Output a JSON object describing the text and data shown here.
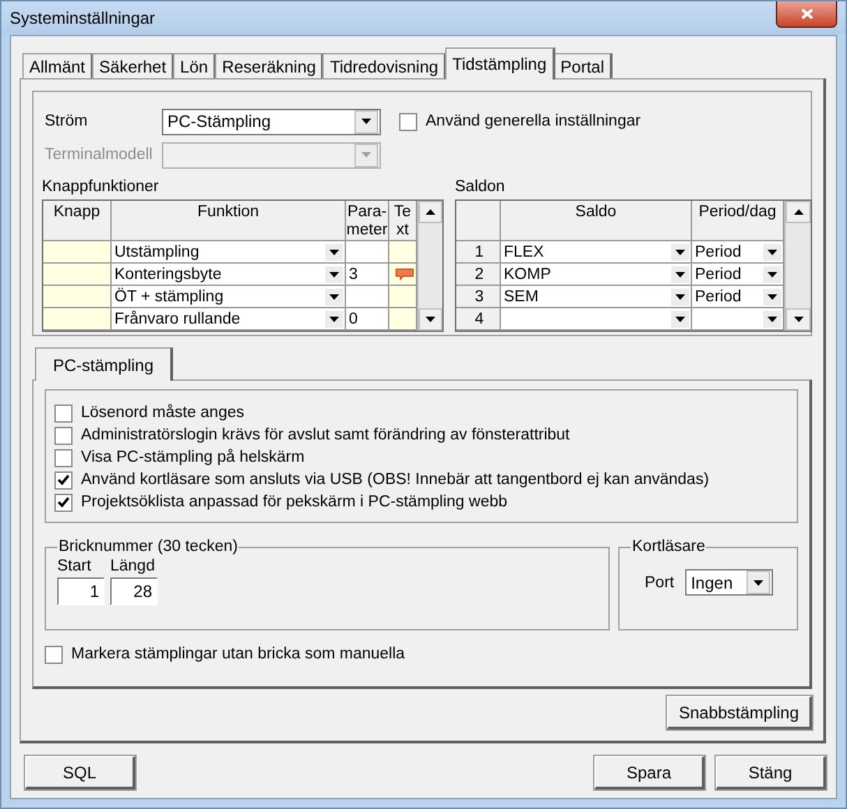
{
  "window": {
    "title": "Systeminställningar"
  },
  "tabs": [
    {
      "label": "Allmänt",
      "selected": false
    },
    {
      "label": "Säkerhet",
      "selected": false
    },
    {
      "label": "Lön",
      "selected": false
    },
    {
      "label": "Reseräkning",
      "selected": false
    },
    {
      "label": "Tidredovisning",
      "selected": false
    },
    {
      "label": "Tidstämpling",
      "selected": true
    },
    {
      "label": "Portal",
      "selected": false
    }
  ],
  "strom": {
    "label": "Ström",
    "value": "PC-Stämpling"
  },
  "use_general": {
    "label": "Använd generella inställningar",
    "checked": false
  },
  "terminal_model": {
    "label": "Terminalmodell",
    "disabled": true
  },
  "button_functions": {
    "title": "Knappfunktioner",
    "columns": [
      [
        "Knapp"
      ],
      [
        "Funktion"
      ],
      [
        "Para-",
        "meter"
      ],
      [
        "Te",
        "xt"
      ]
    ],
    "rows": [
      {
        "function": "Utstämpling",
        "has_text": false
      },
      {
        "function": "Konteringsbyte",
        "parameter": "3",
        "has_text": true
      },
      {
        "function": "ÖT + stämpling",
        "has_text": false
      },
      {
        "function": "Frånvaro rullande",
        "parameter": "0",
        "has_text": false
      }
    ]
  },
  "balances": {
    "title": "Saldon",
    "columns": [
      "Saldo",
      "Period/dag"
    ],
    "rows": [
      {
        "number": "1",
        "balance": "FLEX",
        "period": "Period"
      },
      {
        "number": "2",
        "balance": "KOMP",
        "period": "Period"
      },
      {
        "number": "3",
        "balance": "SEM",
        "period": "Period"
      },
      {
        "number": "4"
      }
    ]
  },
  "subtab": {
    "label": "PC-stämpling",
    "selected": true
  },
  "options": [
    {
      "label": "Lösenord måste anges",
      "checked": false
    },
    {
      "label": "Administratörslogin krävs för avslut samt förändring av fönsterattribut",
      "checked": false
    },
    {
      "label": "Visa PC-stämpling på helskärm",
      "checked": false
    },
    {
      "label": "Använd kortläsare som ansluts via USB (OBS! Innebär att tangentbord ej kan användas)",
      "checked": true
    },
    {
      "label": "Projektsöklista anpassad för pekskärm i PC-stämpling webb",
      "checked": true
    }
  ],
  "tag_number": {
    "title": "Bricknummer (30 tecken)",
    "start": {
      "label": "Start",
      "value": "1"
    },
    "length": {
      "label": "Längd",
      "value": "28"
    }
  },
  "card_reader": {
    "title": "Kortläsare",
    "port": {
      "label": "Port",
      "value": "Ingen"
    }
  },
  "mark_manual": {
    "label": "Markera stämplingar utan bricka som manuella",
    "checked": false
  },
  "quick_button": "Snabbstämpling",
  "footer": {
    "left": "SQL",
    "right": [
      "Spara",
      "Stäng"
    ]
  }
}
